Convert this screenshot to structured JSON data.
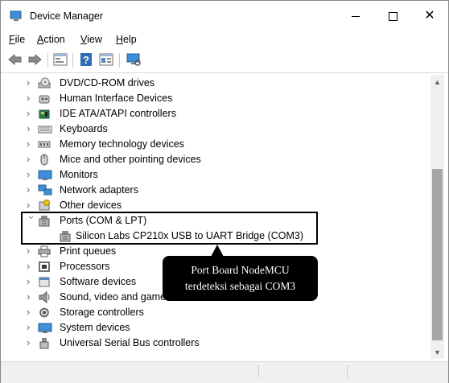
{
  "window": {
    "title": "Device Manager"
  },
  "menu": [
    {
      "key": "F",
      "rest": "ile"
    },
    {
      "key": "A",
      "rest": "ction"
    },
    {
      "key": "V",
      "rest": "iew"
    },
    {
      "key": "H",
      "rest": "elp"
    }
  ],
  "toolbar": [
    "back-icon",
    "forward-icon",
    "properties-icon",
    "help-icon",
    "update-driver-icon",
    "scan-hardware-icon"
  ],
  "tree": [
    {
      "label": "DVD/CD-ROM drives",
      "icon": "dvd-drive-icon",
      "expanded": false
    },
    {
      "label": "Human Interface Devices",
      "icon": "hid-icon",
      "expanded": false
    },
    {
      "label": "IDE ATA/ATAPI controllers",
      "icon": "ide-controller-icon",
      "expanded": false
    },
    {
      "label": "Keyboards",
      "icon": "keyboard-icon",
      "expanded": false
    },
    {
      "label": "Memory technology devices",
      "icon": "memory-device-icon",
      "expanded": false
    },
    {
      "label": "Mice and other pointing devices",
      "icon": "mouse-icon",
      "expanded": false
    },
    {
      "label": "Monitors",
      "icon": "monitor-icon",
      "expanded": false
    },
    {
      "label": "Network adapters",
      "icon": "network-adapter-icon",
      "expanded": false
    },
    {
      "label": "Other devices",
      "icon": "other-devices-icon",
      "expanded": false
    },
    {
      "label": "Ports (COM & LPT)",
      "icon": "port-icon",
      "expanded": true,
      "children": [
        {
          "label": "Silicon Labs CP210x USB to UART Bridge (COM3)",
          "icon": "port-icon"
        }
      ]
    },
    {
      "label": "Print queues",
      "icon": "printer-icon",
      "expanded": false
    },
    {
      "label": "Processors",
      "icon": "processor-icon",
      "expanded": false
    },
    {
      "label": "Software devices",
      "icon": "software-device-icon",
      "expanded": false
    },
    {
      "label": "Sound, video and game controllers",
      "icon": "speaker-icon",
      "expanded": false
    },
    {
      "label": "Storage controllers",
      "icon": "storage-controller-icon",
      "expanded": false
    },
    {
      "label": "System devices",
      "icon": "system-device-icon",
      "expanded": false
    },
    {
      "label": "Universal Serial Bus controllers",
      "icon": "usb-icon",
      "expanded": false
    }
  ],
  "annotation": {
    "line1": "Port Board NodeMCU",
    "line2": "terdeteksi sebagai COM3"
  },
  "colors": {
    "icon_blue": "#2f6db5",
    "monitor_blue": "#3c8fd8",
    "highlight_border": "#000000",
    "callout_bg": "#000000"
  }
}
